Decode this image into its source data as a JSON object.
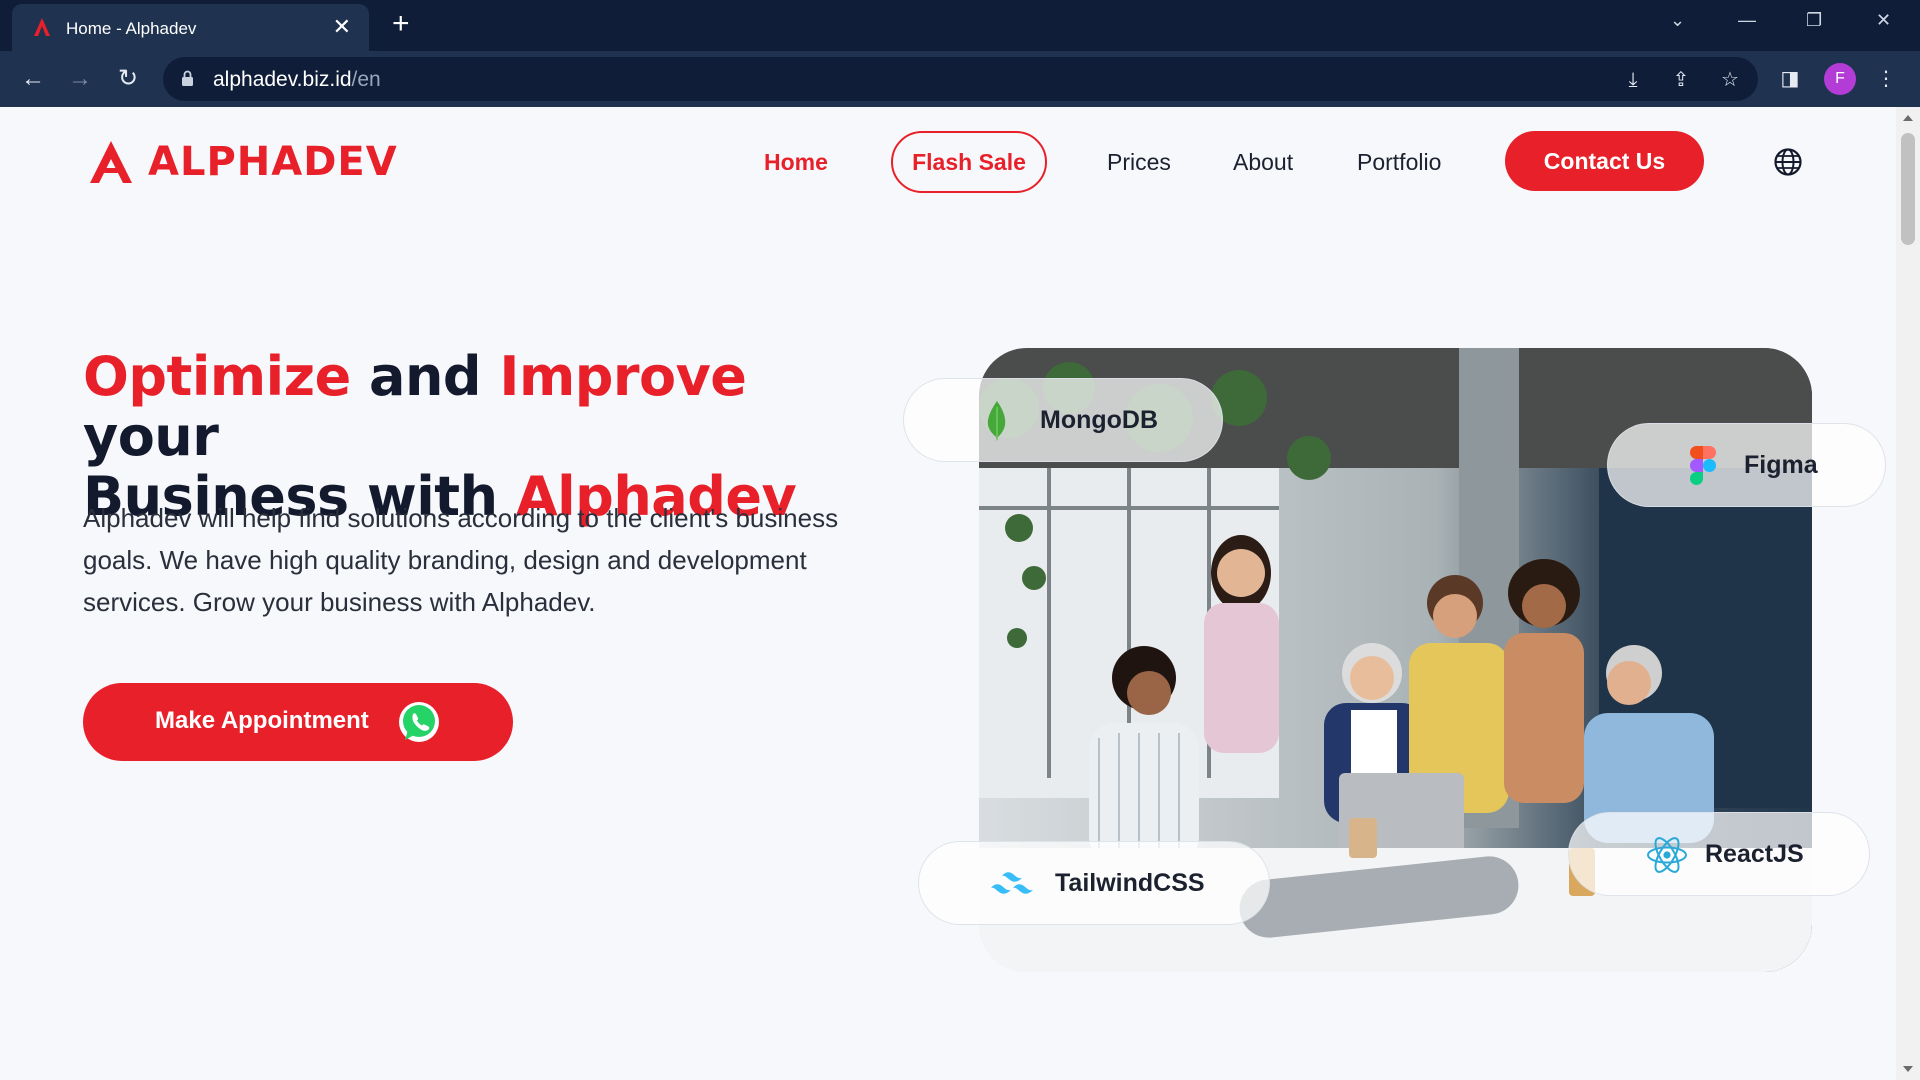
{
  "browser": {
    "tab_title": "Home - Alphadev",
    "tab_close": "✕",
    "new_tab": "+",
    "url_host": "alphadev.biz.id",
    "url_path": "/en",
    "profile_initial": "F"
  },
  "header": {
    "brand": "ALPHADEV",
    "nav": {
      "home": "Home",
      "flash_sale": "Flash Sale",
      "prices": "Prices",
      "about": "About",
      "portfolio": "Portfolio",
      "contact": "Contact Us"
    }
  },
  "hero": {
    "headline": {
      "w1": "Optimize",
      "w2": " and ",
      "w3": "Improve",
      "w4": " your",
      "w5": "Business with ",
      "w6": "Alphadev"
    },
    "description": "Alphadev will help find solutions according to the client's business goals. We have high quality branding, design and development services. Grow your business with Alphadev.",
    "cta_label": "Make Appointment",
    "tech_chips": {
      "mongodb": "MongoDB",
      "figma": "Figma",
      "tailwind": "TailwindCSS",
      "react": "ReactJS"
    }
  },
  "colors": {
    "brand_red": "#e8202a",
    "chrome_dark": "#0f1d38",
    "chrome_toolbar": "#1f3250",
    "page_bg": "#f7f8fb"
  },
  "icons": [
    "alphadev-favicon",
    "back-arrow-icon",
    "forward-arrow-icon",
    "reload-icon",
    "lock-icon",
    "install-icon",
    "share-icon",
    "star-icon",
    "side-panel-icon",
    "kebab-menu-icon",
    "globe-icon",
    "whatsapp-icon",
    "mongodb-icon",
    "figma-icon",
    "tailwind-icon",
    "react-icon"
  ]
}
